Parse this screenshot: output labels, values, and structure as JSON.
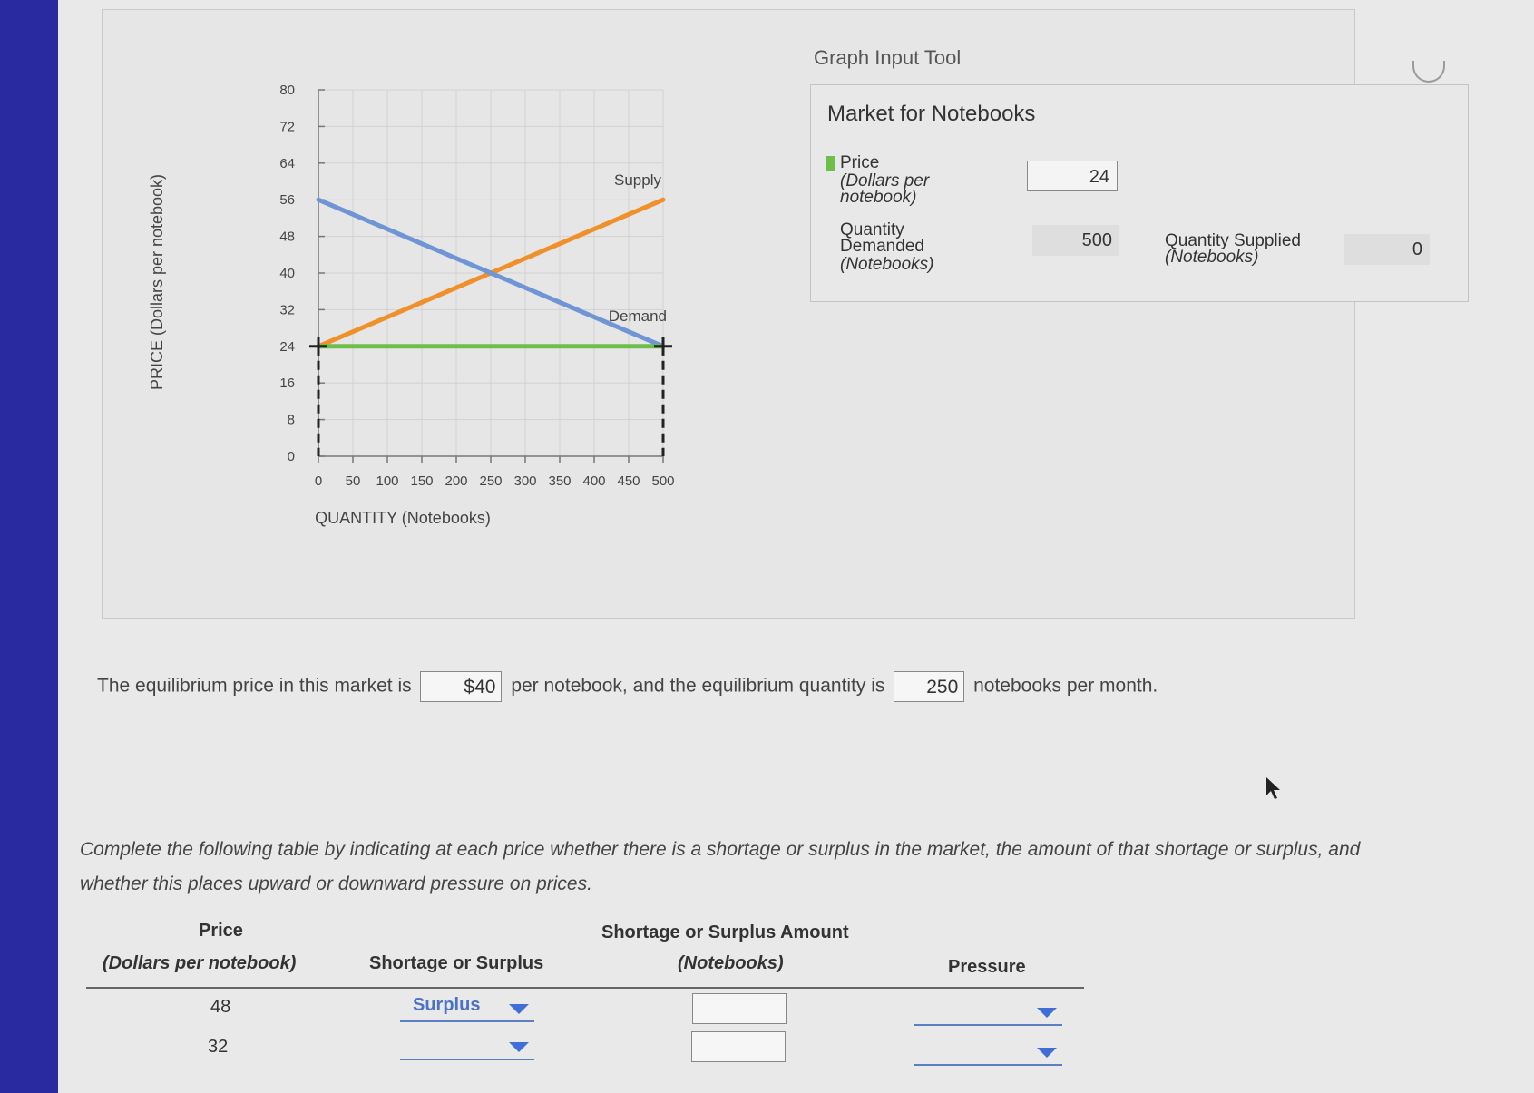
{
  "tool": {
    "header": "Graph Input Tool"
  },
  "market": {
    "title": "Market for Notebooks",
    "price_label": "Price",
    "price_unit_1": "(Dollars per",
    "price_unit_2": "notebook)",
    "price_value": "24",
    "qd_label_1": "Quantity",
    "qd_label_2": "Demanded",
    "qd_unit": "(Notebooks)",
    "qd_value": "500",
    "qs_label": "Quantity Supplied",
    "qs_unit": "(Notebooks)",
    "qs_value": "0"
  },
  "chart_data": {
    "type": "line",
    "ylabel": "PRICE (Dollars per notebook)",
    "xlabel": "QUANTITY (Notebooks)",
    "xlim": [
      0,
      500
    ],
    "ylim": [
      0,
      80
    ],
    "xticks": [
      0,
      50,
      100,
      150,
      200,
      250,
      300,
      350,
      400,
      450,
      500
    ],
    "yticks": [
      0,
      8,
      16,
      24,
      32,
      40,
      48,
      56,
      64,
      72,
      80
    ],
    "grid": true,
    "series": [
      {
        "name": "Supply",
        "color": "#f0902a",
        "x": [
          0,
          500
        ],
        "y": [
          24,
          56
        ]
      },
      {
        "name": "Demand",
        "color": "#6f95d4",
        "x": [
          0,
          500
        ],
        "y": [
          56,
          24
        ]
      },
      {
        "name": "Price",
        "color": "#6cbf4a",
        "x": [
          0,
          500
        ],
        "y": [
          24,
          24
        ]
      }
    ],
    "markers": [
      {
        "x": 0,
        "y": 24
      },
      {
        "x": 500,
        "y": 24
      }
    ]
  },
  "equilibrium": {
    "text_1": "The equilibrium price in this market is",
    "price": "$40",
    "text_2": "per notebook, and the equilibrium quantity is",
    "quantity": "250",
    "text_3": "notebooks per month."
  },
  "instruction": "Complete the following table by indicating at each price whether there is a shortage or surplus in the market, the amount of that shortage or surplus, and whether this places upward or downward pressure on prices.",
  "table": {
    "col_price_1": "Price",
    "col_price_2": "(Dollars per notebook)",
    "col_ss": "Shortage or Surplus",
    "col_amount_1": "Shortage or Surplus Amount",
    "col_amount_2": "(Notebooks)",
    "col_pressure": "Pressure",
    "rows": [
      {
        "price": "48",
        "shortage_surplus": "Surplus",
        "amount": "",
        "pressure": ""
      },
      {
        "price": "32",
        "shortage_surplus": "",
        "amount": "",
        "pressure": ""
      }
    ]
  }
}
